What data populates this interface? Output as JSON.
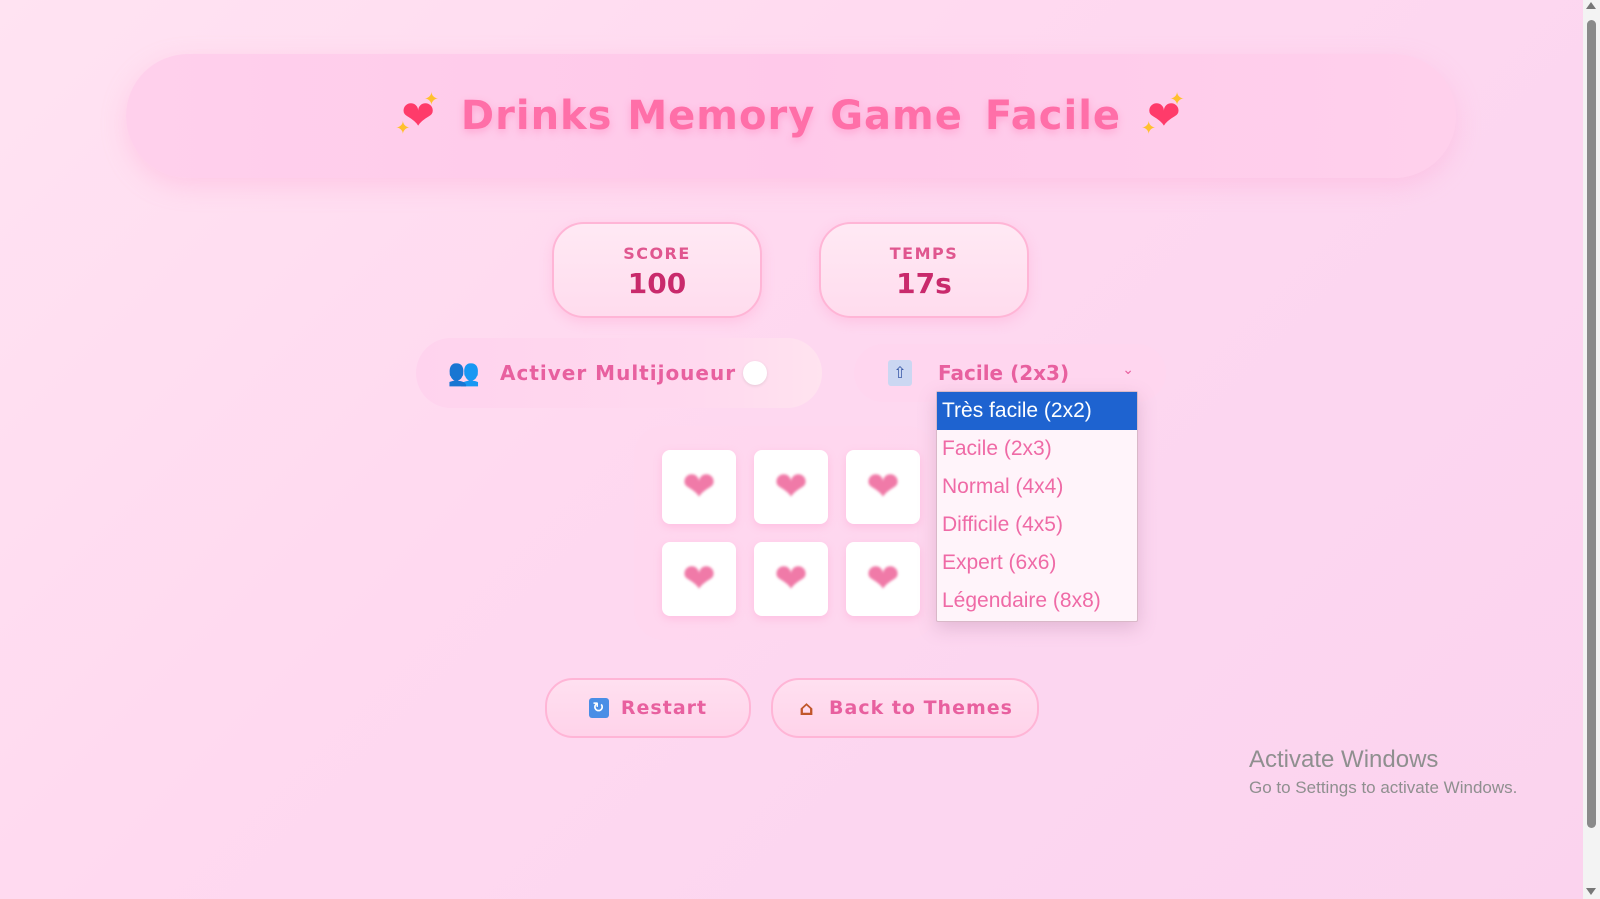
{
  "header": {
    "title": "Drinks Memory Game",
    "level": "Facile",
    "left_icon": "sparkling-heart-icon",
    "right_icon": "sparkling-heart-icon"
  },
  "stats": {
    "score_label": "SCORE",
    "score_value": "100",
    "time_label": "TEMPS",
    "time_value": "17s"
  },
  "multiplayer": {
    "icon": "users-icon",
    "label": "Activer Multijoueur",
    "enabled": false
  },
  "difficulty": {
    "icon": "difficulty-icon",
    "selected": "Facile (2x3)",
    "options": [
      "Très facile (2x2)",
      "Facile (2x3)",
      "Normal (4x4)",
      "Difficile (4x5)",
      "Expert (6x6)",
      "Légendaire (8x8)"
    ],
    "highlighted_option": "Très facile (2x2)"
  },
  "board": {
    "rows": 2,
    "cols": 3,
    "card_back_icon": "heart-icon"
  },
  "actions": {
    "restart_label": "Restart",
    "restart_icon": "refresh-icon",
    "back_label": "Back to Themes",
    "back_icon": "house-icon"
  },
  "os_watermark": {
    "title": "Activate Windows",
    "subtitle": "Go to Settings to activate Windows."
  },
  "colors": {
    "accent": "#ff6fa8",
    "stat_value": "#c92a6c",
    "dropdown_highlight": "#1e63d0"
  }
}
